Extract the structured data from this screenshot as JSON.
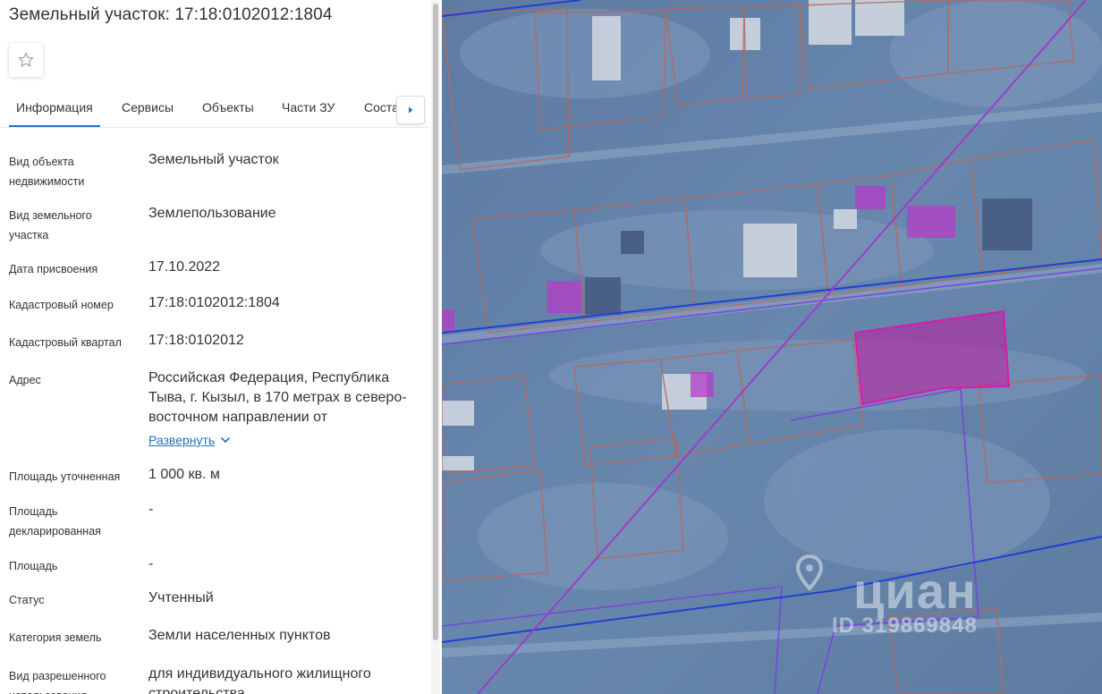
{
  "panel": {
    "title": "Земельный участок: 17:18:0102012:1804",
    "tabs": [
      "Информация",
      "Сервисы",
      "Объекты",
      "Части ЗУ",
      "Соста"
    ],
    "active_tab": "Информация",
    "expand_label": "Развернуть",
    "rows": [
      {
        "label": "Вид объекта недвижимости",
        "value": "Земельный участок"
      },
      {
        "label": "Вид земельного участка",
        "value": "Землепользование"
      },
      {
        "label": "Дата присвоения",
        "value": "17.10.2022"
      },
      {
        "label": "Кадастровый номер",
        "value": "17:18:0102012:1804"
      },
      {
        "label": "Кадастровый квартал",
        "value": "17:18:0102012"
      },
      {
        "label": "Адрес",
        "value": "Российская Федерация, Республика Тыва, г. Кызыл, в 170 метрах в северо-восточном направлении от"
      },
      {
        "label": "Площадь уточненная",
        "value": "1 000 кв. м"
      },
      {
        "label": "Площадь декларированная",
        "value": "-"
      },
      {
        "label": "Площадь",
        "value": "-"
      },
      {
        "label": "Статус",
        "value": "Учтенный"
      },
      {
        "label": "Категория земель",
        "value": "Земли населенных пунктов"
      },
      {
        "label": "Вид разрешенного использования",
        "value": "для индивидуального жилищного строительства"
      }
    ]
  },
  "map": {
    "watermark_brand": "циан",
    "watermark_id": "ID 319869848",
    "colors": {
      "selected_parcel": "#c01aa0",
      "parcel_border": "#b8685a",
      "boundary": "#1f3fd6",
      "diagonal_line": "#a03cc8"
    }
  },
  "icons": {
    "favorite": "star-outline-icon",
    "tabs_next": "triangle-right-icon",
    "expand": "chevron-down-icon",
    "watermark_pin": "location-pin-icon"
  }
}
